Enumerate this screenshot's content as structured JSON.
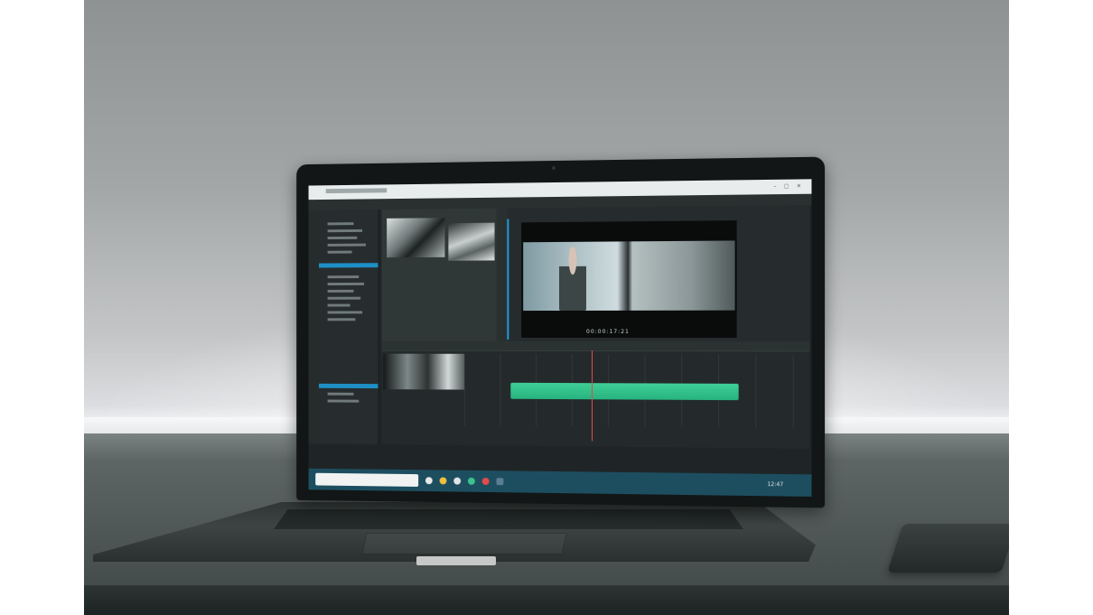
{
  "scene": {
    "description_free": true
  },
  "screen": {
    "viewer_timecode": "00:00:17:21",
    "taskbar_time": "12:47"
  },
  "colors": {
    "timeline_clip": "#3fcf97",
    "selection": "#1e8fc6",
    "taskbar": "#1d4e60",
    "playhead": "#e24b4b"
  }
}
